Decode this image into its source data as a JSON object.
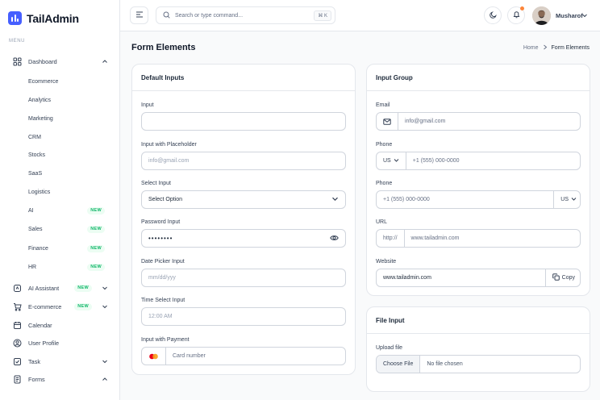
{
  "brand": {
    "name": "TailAdmin"
  },
  "sidebar": {
    "menu_label": "MENU",
    "dashboard": {
      "label": "Dashboard",
      "icon": "grid-icon"
    },
    "sub_items": [
      {
        "label": "Ecommerce"
      },
      {
        "label": "Analytics"
      },
      {
        "label": "Marketing"
      },
      {
        "label": "CRM"
      },
      {
        "label": "Stocks"
      },
      {
        "label": "SaaS"
      },
      {
        "label": "Logistics"
      },
      {
        "label": "AI",
        "badge": "NEW"
      },
      {
        "label": "Sales",
        "badge": "NEW"
      },
      {
        "label": "Finance",
        "badge": "NEW"
      },
      {
        "label": "HR",
        "badge": "NEW"
      }
    ],
    "items": [
      {
        "label": "AI Assistant",
        "badge": "NEW",
        "icon": "ai-icon"
      },
      {
        "label": "E-commerce",
        "badge": "NEW",
        "icon": "cart-icon"
      },
      {
        "label": "Calendar",
        "icon": "calendar-icon"
      },
      {
        "label": "User Profile",
        "icon": "user-icon"
      },
      {
        "label": "Task",
        "icon": "task-icon"
      },
      {
        "label": "Forms",
        "icon": "forms-icon"
      }
    ]
  },
  "header": {
    "search_placeholder": "Search or type command...",
    "shortcut": "⌘ K",
    "user_name": "Musharof"
  },
  "page": {
    "title": "Form Elements",
    "breadcrumb_home": "Home",
    "breadcrumb_current": "Form Elements"
  },
  "default_inputs": {
    "title": "Default Inputs",
    "input_label": "Input",
    "placeholder_label": "Input with Placeholder",
    "placeholder_value": "info@gmail.com",
    "select_label": "Select Input",
    "select_value": "Select Option",
    "password_label": "Password Input",
    "password_value": "••••••••",
    "date_label": "Date Picker Input",
    "date_placeholder": "mm/dd/yyy",
    "time_label": "Time Select Input",
    "time_placeholder": "12:00 AM",
    "payment_label": "Input with Payment",
    "payment_placeholder": "Card number"
  },
  "input_group": {
    "title": "Input Group",
    "email_label": "Email",
    "email_placeholder": "info@gmail.com",
    "phone_label": "Phone",
    "phone_country": "US",
    "phone_placeholder": "+1 (555) 000-0000",
    "phone2_label": "Phone",
    "phone2_placeholder": "+1 (555) 000-0000",
    "phone2_country": "US",
    "url_label": "URL",
    "url_prefix": "http://",
    "url_value": "www.tailadmin.com",
    "website_label": "Website",
    "website_value": "www.tailadmin.com",
    "copy_label": "Copy"
  },
  "file_input": {
    "title": "File Input",
    "upload_label": "Upload file",
    "choose_label": "Choose File",
    "no_file": "No file chosen"
  }
}
